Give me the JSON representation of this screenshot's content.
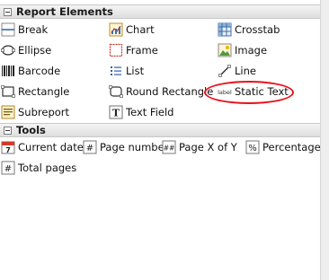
{
  "sections": {
    "report_elements": {
      "title": "Report Elements"
    },
    "tools": {
      "title": "Tools"
    }
  },
  "elements": {
    "break": "Break",
    "chart": "Chart",
    "crosstab": "Crosstab",
    "ellipse": "Ellipse",
    "frame": "Frame",
    "image": "Image",
    "barcode": "Barcode",
    "list": "List",
    "line": "Line",
    "rectangle": "Rectangle",
    "round_rectangle": "Round Rectangle",
    "static_text": "Static Text",
    "static_text_icon_text": "label",
    "subreport": "Subreport",
    "text_field": "Text Field"
  },
  "tools": {
    "current_date": "Current date",
    "current_date_icon_text": "7",
    "page_number": "Page number",
    "page_x_of_y": "Page X of Y",
    "percentage": "Percentage",
    "total_pages": "Total pages"
  },
  "colors": {
    "highlight": "#e8101c",
    "header_bg": "#e4e4e4"
  }
}
